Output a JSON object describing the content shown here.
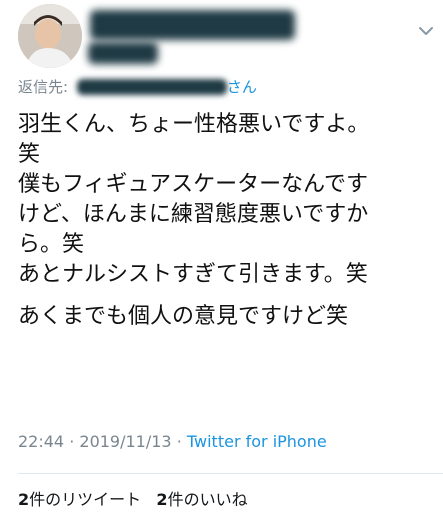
{
  "reply": {
    "prefix": "返信先:",
    "handle_suffix": "さん"
  },
  "tweet": {
    "lines": [
      "羽生くん、ちょー性格悪いですよ。",
      "笑",
      "僕もフィギュアスケーターなんです",
      "けど、ほんまに練習態度悪いですか",
      "ら。笑",
      "あとナルシストすぎて引きます。笑",
      "あくまでも個人の意見ですけど笑"
    ]
  },
  "meta": {
    "time": "22:44",
    "date": "2019/11/13",
    "separator": "·",
    "source": "Twitter for iPhone"
  },
  "stats": {
    "retweets_count": "2",
    "retweets_label": "件のリツイート",
    "likes_count": "2",
    "likes_label": "件のいいね"
  },
  "colors": {
    "link": "#1b95e0",
    "muted": "#7a868f",
    "divider": "#e1e8ed"
  },
  "icons": {
    "menu": "chevron-down-icon"
  }
}
